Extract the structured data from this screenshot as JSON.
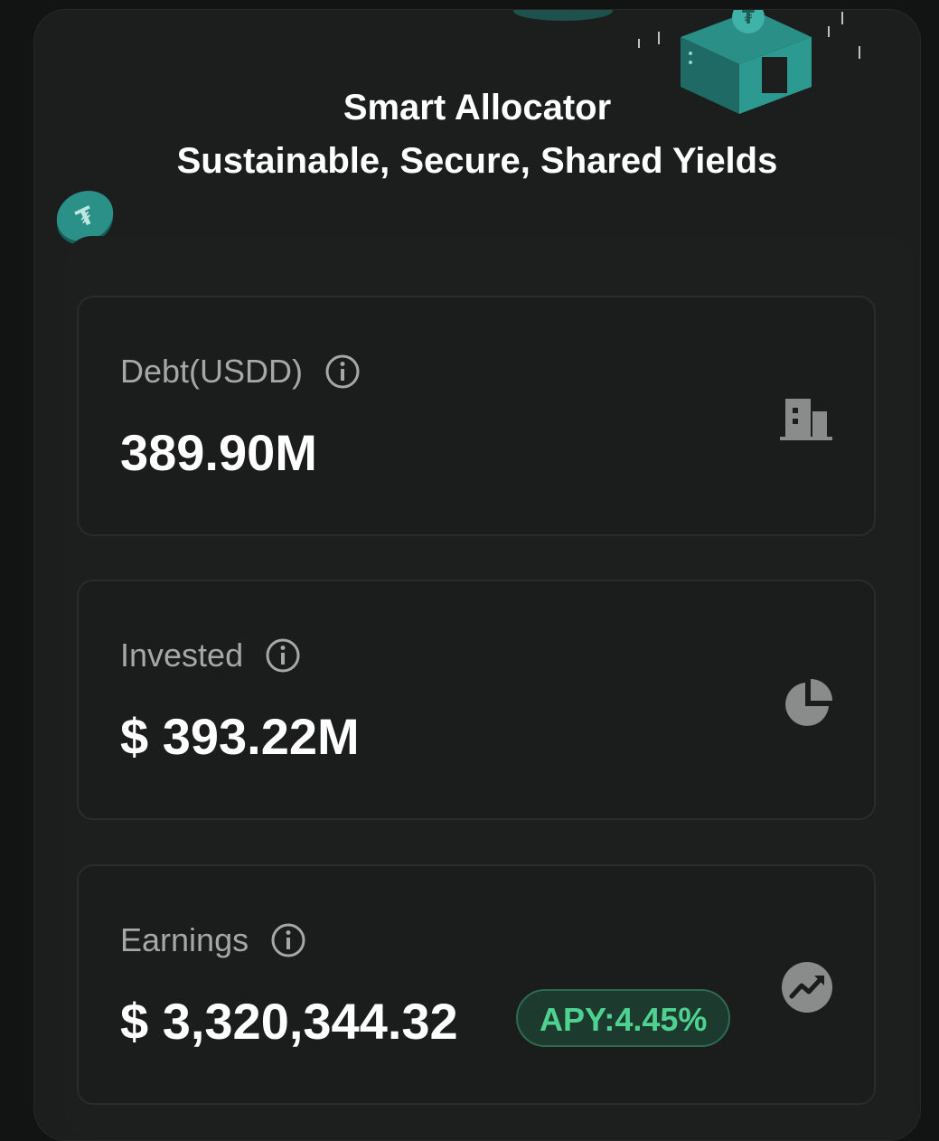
{
  "header": {
    "title": "Smart Allocator",
    "subtitle": "Sustainable, Secure, Shared Yields"
  },
  "cards": [
    {
      "label": "Debt(USDD)",
      "value": "389.90M",
      "icon": "building-icon"
    },
    {
      "label": "Invested",
      "value": "$ 393.22M",
      "icon": "pie-chart-icon"
    },
    {
      "label": "Earnings",
      "value": "$ 3,320,344.32",
      "icon": "trending-up-icon",
      "badge": "APY:4.45%"
    }
  ],
  "colors": {
    "background": "#121413",
    "panel": "#1c1d1d",
    "card_border": "#2a2c2c",
    "label": "#a6a8a8",
    "value": "#ffffff",
    "apy_text": "#4fd28f",
    "apy_bg": "#1d3a2f",
    "accent_teal": "#2a8f86"
  }
}
